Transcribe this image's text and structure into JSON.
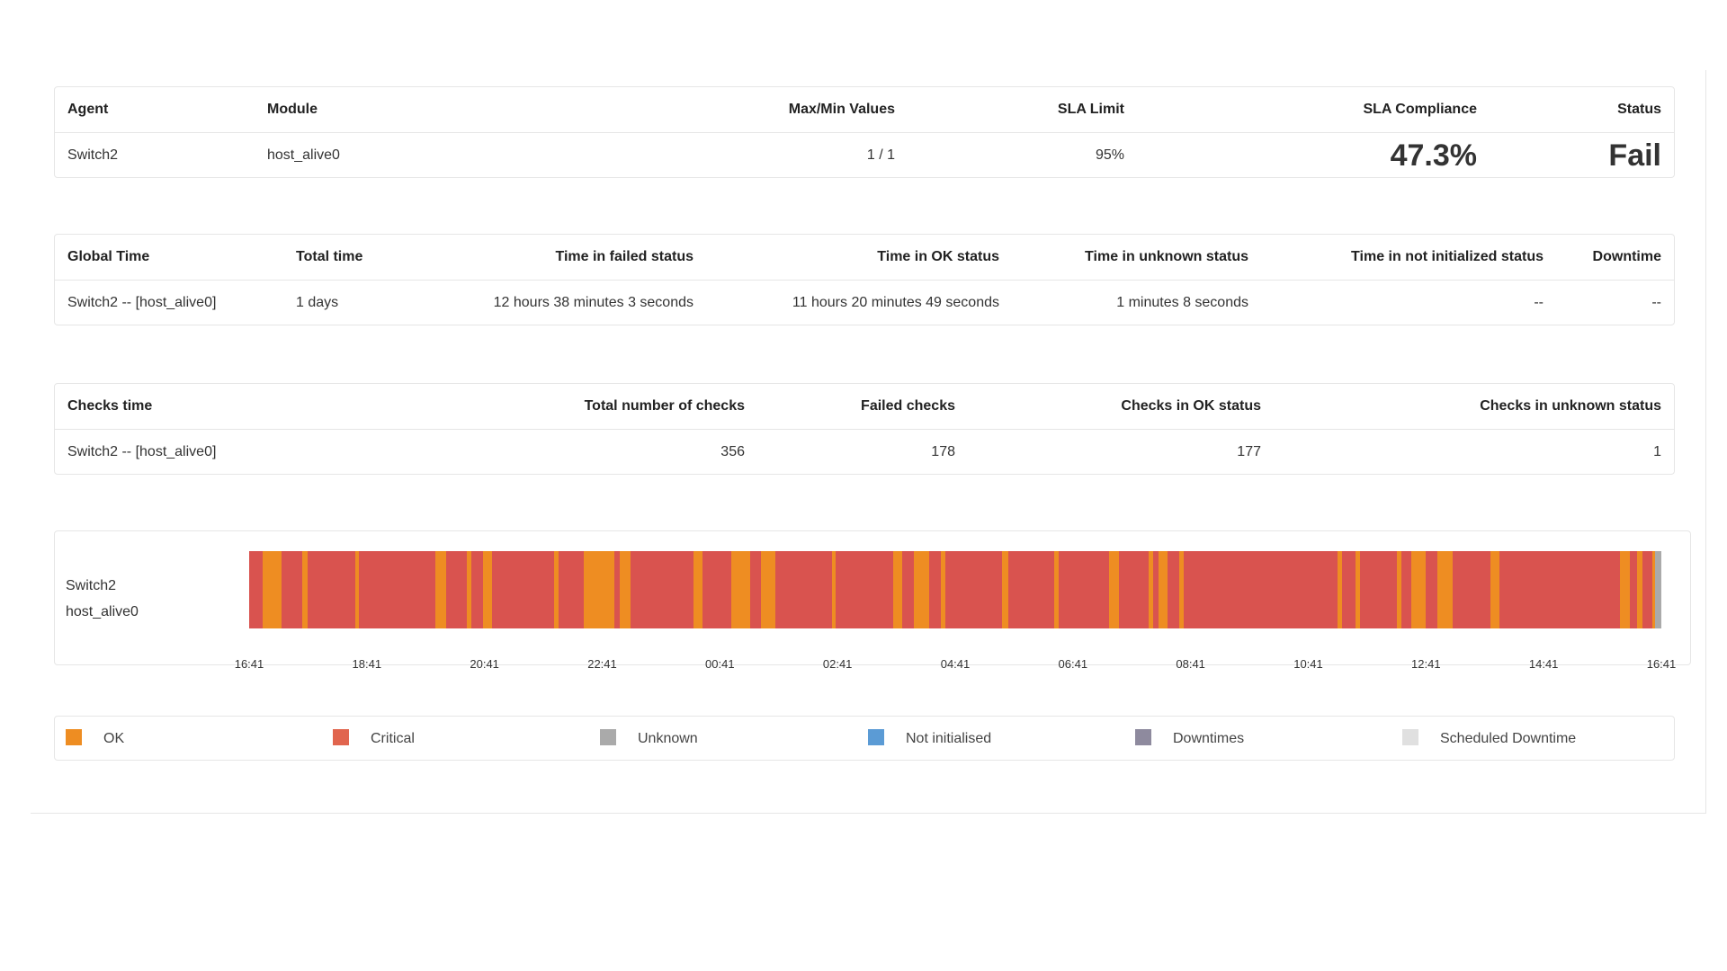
{
  "colors": {
    "ok": "#ee8d22",
    "critical": "#d9534f",
    "unknown": "#aaaaaa",
    "not_initialised": "#5b9bd5",
    "downtime": "#8e8a9e",
    "scheduled_downtime": "#e0e0e0",
    "fail_text": "#d9534f"
  },
  "sla_table": {
    "headers": [
      "Agent",
      "Module",
      "Max/Min Values",
      "SLA Limit",
      "SLA Compliance",
      "Status"
    ],
    "row": {
      "agent": "Switch2",
      "module": "host_alive0",
      "maxmin": "1 / 1",
      "sla_limit": "95%",
      "compliance": "47.3%",
      "status": "Fail"
    }
  },
  "time_table": {
    "headers": [
      "Global Time",
      "Total time",
      "Time in failed status",
      "Time in OK status",
      "Time in unknown status",
      "Time in not initialized status",
      "Downtime"
    ],
    "row": {
      "global_time": "Switch2 -- [host_alive0]",
      "total_time": "1 days",
      "failed": "12 hours 38 minutes 3 seconds",
      "ok": "11 hours 20 minutes 49 seconds",
      "unknown": "1 minutes 8 seconds",
      "not_initialized": "--",
      "downtime": "--"
    }
  },
  "checks_table": {
    "headers": [
      "Checks time",
      "Total number of checks",
      "Failed checks",
      "Checks in OK status",
      "Checks in unknown status"
    ],
    "row": {
      "checks_time": "Switch2 -- [host_alive0]",
      "total": "356",
      "failed": "178",
      "ok": "177",
      "unknown": "1"
    }
  },
  "chart": {
    "agent": "Switch2",
    "module": "host_alive0",
    "tick_labels": [
      "16:41",
      "18:41",
      "20:41",
      "22:41",
      "00:41",
      "02:41",
      "04:41",
      "06:41",
      "08:41",
      "10:41",
      "12:41",
      "14:41",
      "16:41"
    ]
  },
  "chart_data": {
    "type": "timeline",
    "x_range_hours": [
      0,
      24
    ],
    "segments": [
      {
        "status": "critical",
        "start": 0.0,
        "end": 0.23
      },
      {
        "status": "ok",
        "start": 0.23,
        "end": 0.55
      },
      {
        "status": "critical",
        "start": 0.55,
        "end": 0.9
      },
      {
        "status": "ok",
        "start": 0.9,
        "end": 1.0
      },
      {
        "status": "critical",
        "start": 1.0,
        "end": 1.8
      },
      {
        "status": "ok",
        "start": 1.8,
        "end": 1.87
      },
      {
        "status": "critical",
        "start": 1.87,
        "end": 3.17
      },
      {
        "status": "ok",
        "start": 3.17,
        "end": 3.35
      },
      {
        "status": "critical",
        "start": 3.35,
        "end": 3.7
      },
      {
        "status": "ok",
        "start": 3.7,
        "end": 3.78
      },
      {
        "status": "critical",
        "start": 3.78,
        "end": 3.97
      },
      {
        "status": "ok",
        "start": 3.97,
        "end": 4.13
      },
      {
        "status": "critical",
        "start": 4.13,
        "end": 5.18
      },
      {
        "status": "ok",
        "start": 5.18,
        "end": 5.26
      },
      {
        "status": "critical",
        "start": 5.26,
        "end": 5.68
      },
      {
        "status": "ok",
        "start": 5.68,
        "end": 6.2
      },
      {
        "status": "critical",
        "start": 6.2,
        "end": 6.3
      },
      {
        "status": "ok",
        "start": 6.3,
        "end": 6.48
      },
      {
        "status": "critical",
        "start": 6.48,
        "end": 7.55
      },
      {
        "status": "ok",
        "start": 7.55,
        "end": 7.7
      },
      {
        "status": "critical",
        "start": 7.7,
        "end": 8.2
      },
      {
        "status": "ok",
        "start": 8.2,
        "end": 8.52
      },
      {
        "status": "critical",
        "start": 8.52,
        "end": 8.7
      },
      {
        "status": "ok",
        "start": 8.7,
        "end": 8.95
      },
      {
        "status": "critical",
        "start": 8.95,
        "end": 9.9
      },
      {
        "status": "ok",
        "start": 9.9,
        "end": 9.97
      },
      {
        "status": "critical",
        "start": 9.97,
        "end": 10.95
      },
      {
        "status": "ok",
        "start": 10.95,
        "end": 11.1
      },
      {
        "status": "critical",
        "start": 11.1,
        "end": 11.3
      },
      {
        "status": "ok",
        "start": 11.3,
        "end": 11.55
      },
      {
        "status": "critical",
        "start": 11.55,
        "end": 11.75
      },
      {
        "status": "ok",
        "start": 11.75,
        "end": 11.83
      },
      {
        "status": "critical",
        "start": 11.83,
        "end": 12.8
      },
      {
        "status": "ok",
        "start": 12.8,
        "end": 12.9
      },
      {
        "status": "critical",
        "start": 12.9,
        "end": 13.68
      },
      {
        "status": "ok",
        "start": 13.68,
        "end": 13.76
      },
      {
        "status": "critical",
        "start": 13.76,
        "end": 14.62
      },
      {
        "status": "ok",
        "start": 14.62,
        "end": 14.78
      },
      {
        "status": "critical",
        "start": 14.78,
        "end": 15.28
      },
      {
        "status": "ok",
        "start": 15.28,
        "end": 15.36
      },
      {
        "status": "critical",
        "start": 15.36,
        "end": 15.45
      },
      {
        "status": "ok",
        "start": 15.45,
        "end": 15.6
      },
      {
        "status": "critical",
        "start": 15.6,
        "end": 15.8
      },
      {
        "status": "ok",
        "start": 15.8,
        "end": 15.88
      },
      {
        "status": "critical",
        "start": 15.88,
        "end": 18.5
      },
      {
        "status": "ok",
        "start": 18.5,
        "end": 18.58
      },
      {
        "status": "critical",
        "start": 18.58,
        "end": 18.8
      },
      {
        "status": "ok",
        "start": 18.8,
        "end": 18.88
      },
      {
        "status": "critical",
        "start": 18.88,
        "end": 19.5
      },
      {
        "status": "ok",
        "start": 19.5,
        "end": 19.58
      },
      {
        "status": "critical",
        "start": 19.58,
        "end": 19.75
      },
      {
        "status": "ok",
        "start": 19.75,
        "end": 20.0
      },
      {
        "status": "critical",
        "start": 20.0,
        "end": 20.2
      },
      {
        "status": "ok",
        "start": 20.2,
        "end": 20.45
      },
      {
        "status": "critical",
        "start": 20.45,
        "end": 21.1
      },
      {
        "status": "ok",
        "start": 21.1,
        "end": 21.25
      },
      {
        "status": "critical",
        "start": 21.25,
        "end": 23.3
      },
      {
        "status": "ok",
        "start": 23.3,
        "end": 23.47
      },
      {
        "status": "critical",
        "start": 23.47,
        "end": 23.58
      },
      {
        "status": "ok",
        "start": 23.58,
        "end": 23.68
      },
      {
        "status": "critical",
        "start": 23.68,
        "end": 23.85
      },
      {
        "status": "ok",
        "start": 23.85,
        "end": 23.9
      },
      {
        "status": "unknown",
        "start": 23.9,
        "end": 24.0
      }
    ]
  },
  "legend": [
    {
      "label": "OK",
      "color": "#ee8d22"
    },
    {
      "label": "Critical",
      "color": "#e1654e"
    },
    {
      "label": "Unknown",
      "color": "#aaaaaa"
    },
    {
      "label": "Not initialised",
      "color": "#5b9bd5"
    },
    {
      "label": "Downtimes",
      "color": "#8e8a9e"
    },
    {
      "label": "Scheduled Downtime",
      "color": "#e0e0e0"
    }
  ]
}
